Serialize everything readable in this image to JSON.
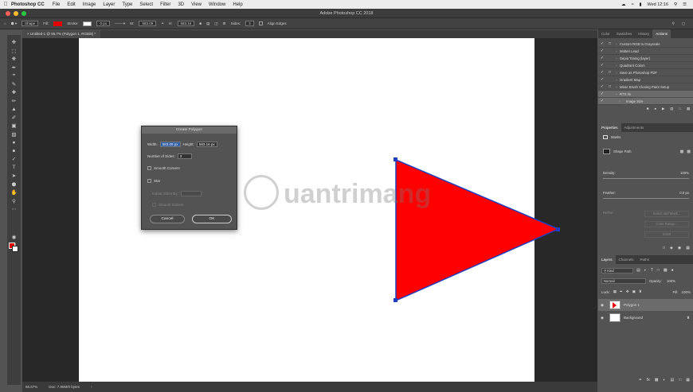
{
  "menubar": {
    "app_name": "Photoshop CC",
    "items": [
      "File",
      "Edit",
      "Image",
      "Layer",
      "Type",
      "Select",
      "Filter",
      "3D",
      "View",
      "Window",
      "Help"
    ],
    "clock": "Wed 12:16"
  },
  "window": {
    "title": "Adobe Photoshop CC 2018"
  },
  "options_bar": {
    "mode": "Shape",
    "fill_label": "Fill:",
    "fill_color": "#e30000",
    "stroke_label": "Stroke:",
    "stroke_width": "0 px",
    "w_label": "W:",
    "w_value": "583.09",
    "h_label": "H:",
    "h_value": "583.16",
    "sides_label": "Sides:",
    "sides_value": "3",
    "align_edges": "Align Edges"
  },
  "document": {
    "tab_label": "Untitled-1 @ 66.7% (Polygon 1, RGB/8) *"
  },
  "shape": {
    "fill": "#ff0000",
    "stroke": "#1f3fbf"
  },
  "watermark": {
    "text": "uantrimang"
  },
  "dialog": {
    "title": "Create Polygon",
    "width_label": "Width:",
    "width_value": "583.09 px",
    "height_label": "Height:",
    "height_value": "583.16 px",
    "sides_label": "Number of Sides:",
    "sides_value": "3",
    "smooth_corners": "Smooth Corners",
    "star": "Star",
    "indent_label": "Indent Sides By:",
    "smooth_indents": "Smooth Indents",
    "cancel": "Cancel",
    "ok": "OK"
  },
  "actions_panel": {
    "tabs": [
      "Color",
      "Swatches",
      "History",
      "Actions"
    ],
    "active_tab": "Actions",
    "items": [
      {
        "label": "Custom RGB to Grayscale",
        "highlight": false
      },
      {
        "label": "Molten Lead",
        "highlight": false
      },
      {
        "label": "Sepia Toning (layer)",
        "highlight": false
      },
      {
        "label": "Quadrant Colors",
        "highlight": false
      },
      {
        "label": "Save as Photoshop PDF",
        "highlight": false
      },
      {
        "label": "Gradient Map",
        "highlight": false
      },
      {
        "label": "Mixer Brush Cloning Paint Setup",
        "highlight": false
      },
      {
        "label": "RTS lm",
        "highlight": true
      },
      {
        "label": "Image Size",
        "highlight": true
      }
    ]
  },
  "properties_panel": {
    "tabs": [
      "Properties",
      "Adjustments"
    ],
    "masks_label": "Masks",
    "shape_path": "Shape Path",
    "density_label": "Density:",
    "density_value": "100%",
    "feather_label": "Feather:",
    "feather_value": "0.0 px",
    "refine_label": "Refine:",
    "select_and_mask": "Select and Mask...",
    "color_range": "Color Range...",
    "invert": "Invert"
  },
  "layers_panel": {
    "tabs": [
      "Layers",
      "Channels",
      "Paths"
    ],
    "kind_label": "Kind",
    "blend_mode": "Normal",
    "opacity_label": "Opacity:",
    "opacity_value": "100%",
    "lock_label": "Lock:",
    "fill_label": "Fill:",
    "fill_value": "100%",
    "layers": [
      {
        "name": "Polygon 1",
        "selected": true
      },
      {
        "name": "Background",
        "selected": false
      }
    ]
  },
  "status_bar": {
    "zoom": "66.67%",
    "doc_info": "Doc: 7.95M/0 bytes"
  }
}
